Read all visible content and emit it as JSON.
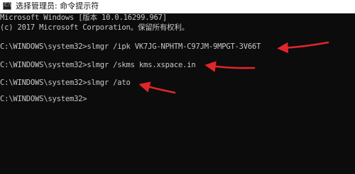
{
  "window": {
    "title": "选择管理员: 命令提示符",
    "icon": "cmd-icon",
    "icon_text": "C:\\",
    "accent_color": "#e0262a"
  },
  "console": {
    "lines": [
      "Microsoft Windows [版本 10.0.16299.967]",
      "(c) 2017 Microsoft Corporation。保留所有权利。",
      "",
      "C:\\WINDOWS\\system32>slmgr /ipk VK7JG-NPHTM-C97JM-9MPGT-3V66T",
      "",
      "C:\\WINDOWS\\system32>slmgr /skms kms.xspace.in",
      "",
      "C:\\WINDOWS\\system32>slmgr /ato",
      "",
      "C:\\WINDOWS\\system32>"
    ]
  },
  "annotations": [
    {
      "name": "red-arrow",
      "points_to": "slmgr /ipk VK7JG-NPHTM-C97JM-9MPGT-3V66T"
    },
    {
      "name": "red-arrow",
      "points_to": "slmgr /skms kms.xspace.in"
    },
    {
      "name": "red-arrow",
      "points_to": "slmgr /ato"
    }
  ]
}
